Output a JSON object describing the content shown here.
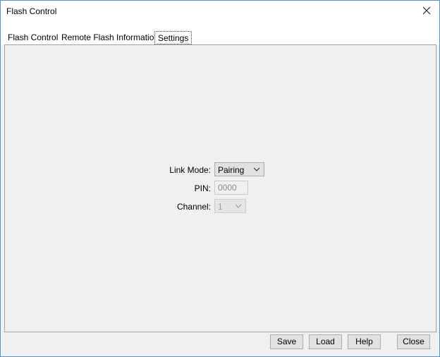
{
  "window": {
    "title": "Flash Control"
  },
  "tabs": [
    {
      "label": "Flash Control"
    },
    {
      "label": "Remote Flash Information"
    },
    {
      "label": "Settings"
    }
  ],
  "form": {
    "link_mode_label": "Link Mode:",
    "link_mode_value": "Pairing",
    "pin_label": "PIN:",
    "pin_value": "0000",
    "channel_label": "Channel:",
    "channel_value": "1"
  },
  "buttons": {
    "save": "Save",
    "load": "Load",
    "help": "Help",
    "close": "Close"
  },
  "colors": {
    "window_border": "#5a8fd0",
    "panel_bg": "#f0f0f0",
    "button_bg": "#e1e1e1"
  },
  "icons": {
    "close": "close-icon",
    "dropdown": "chevron-down-icon"
  }
}
